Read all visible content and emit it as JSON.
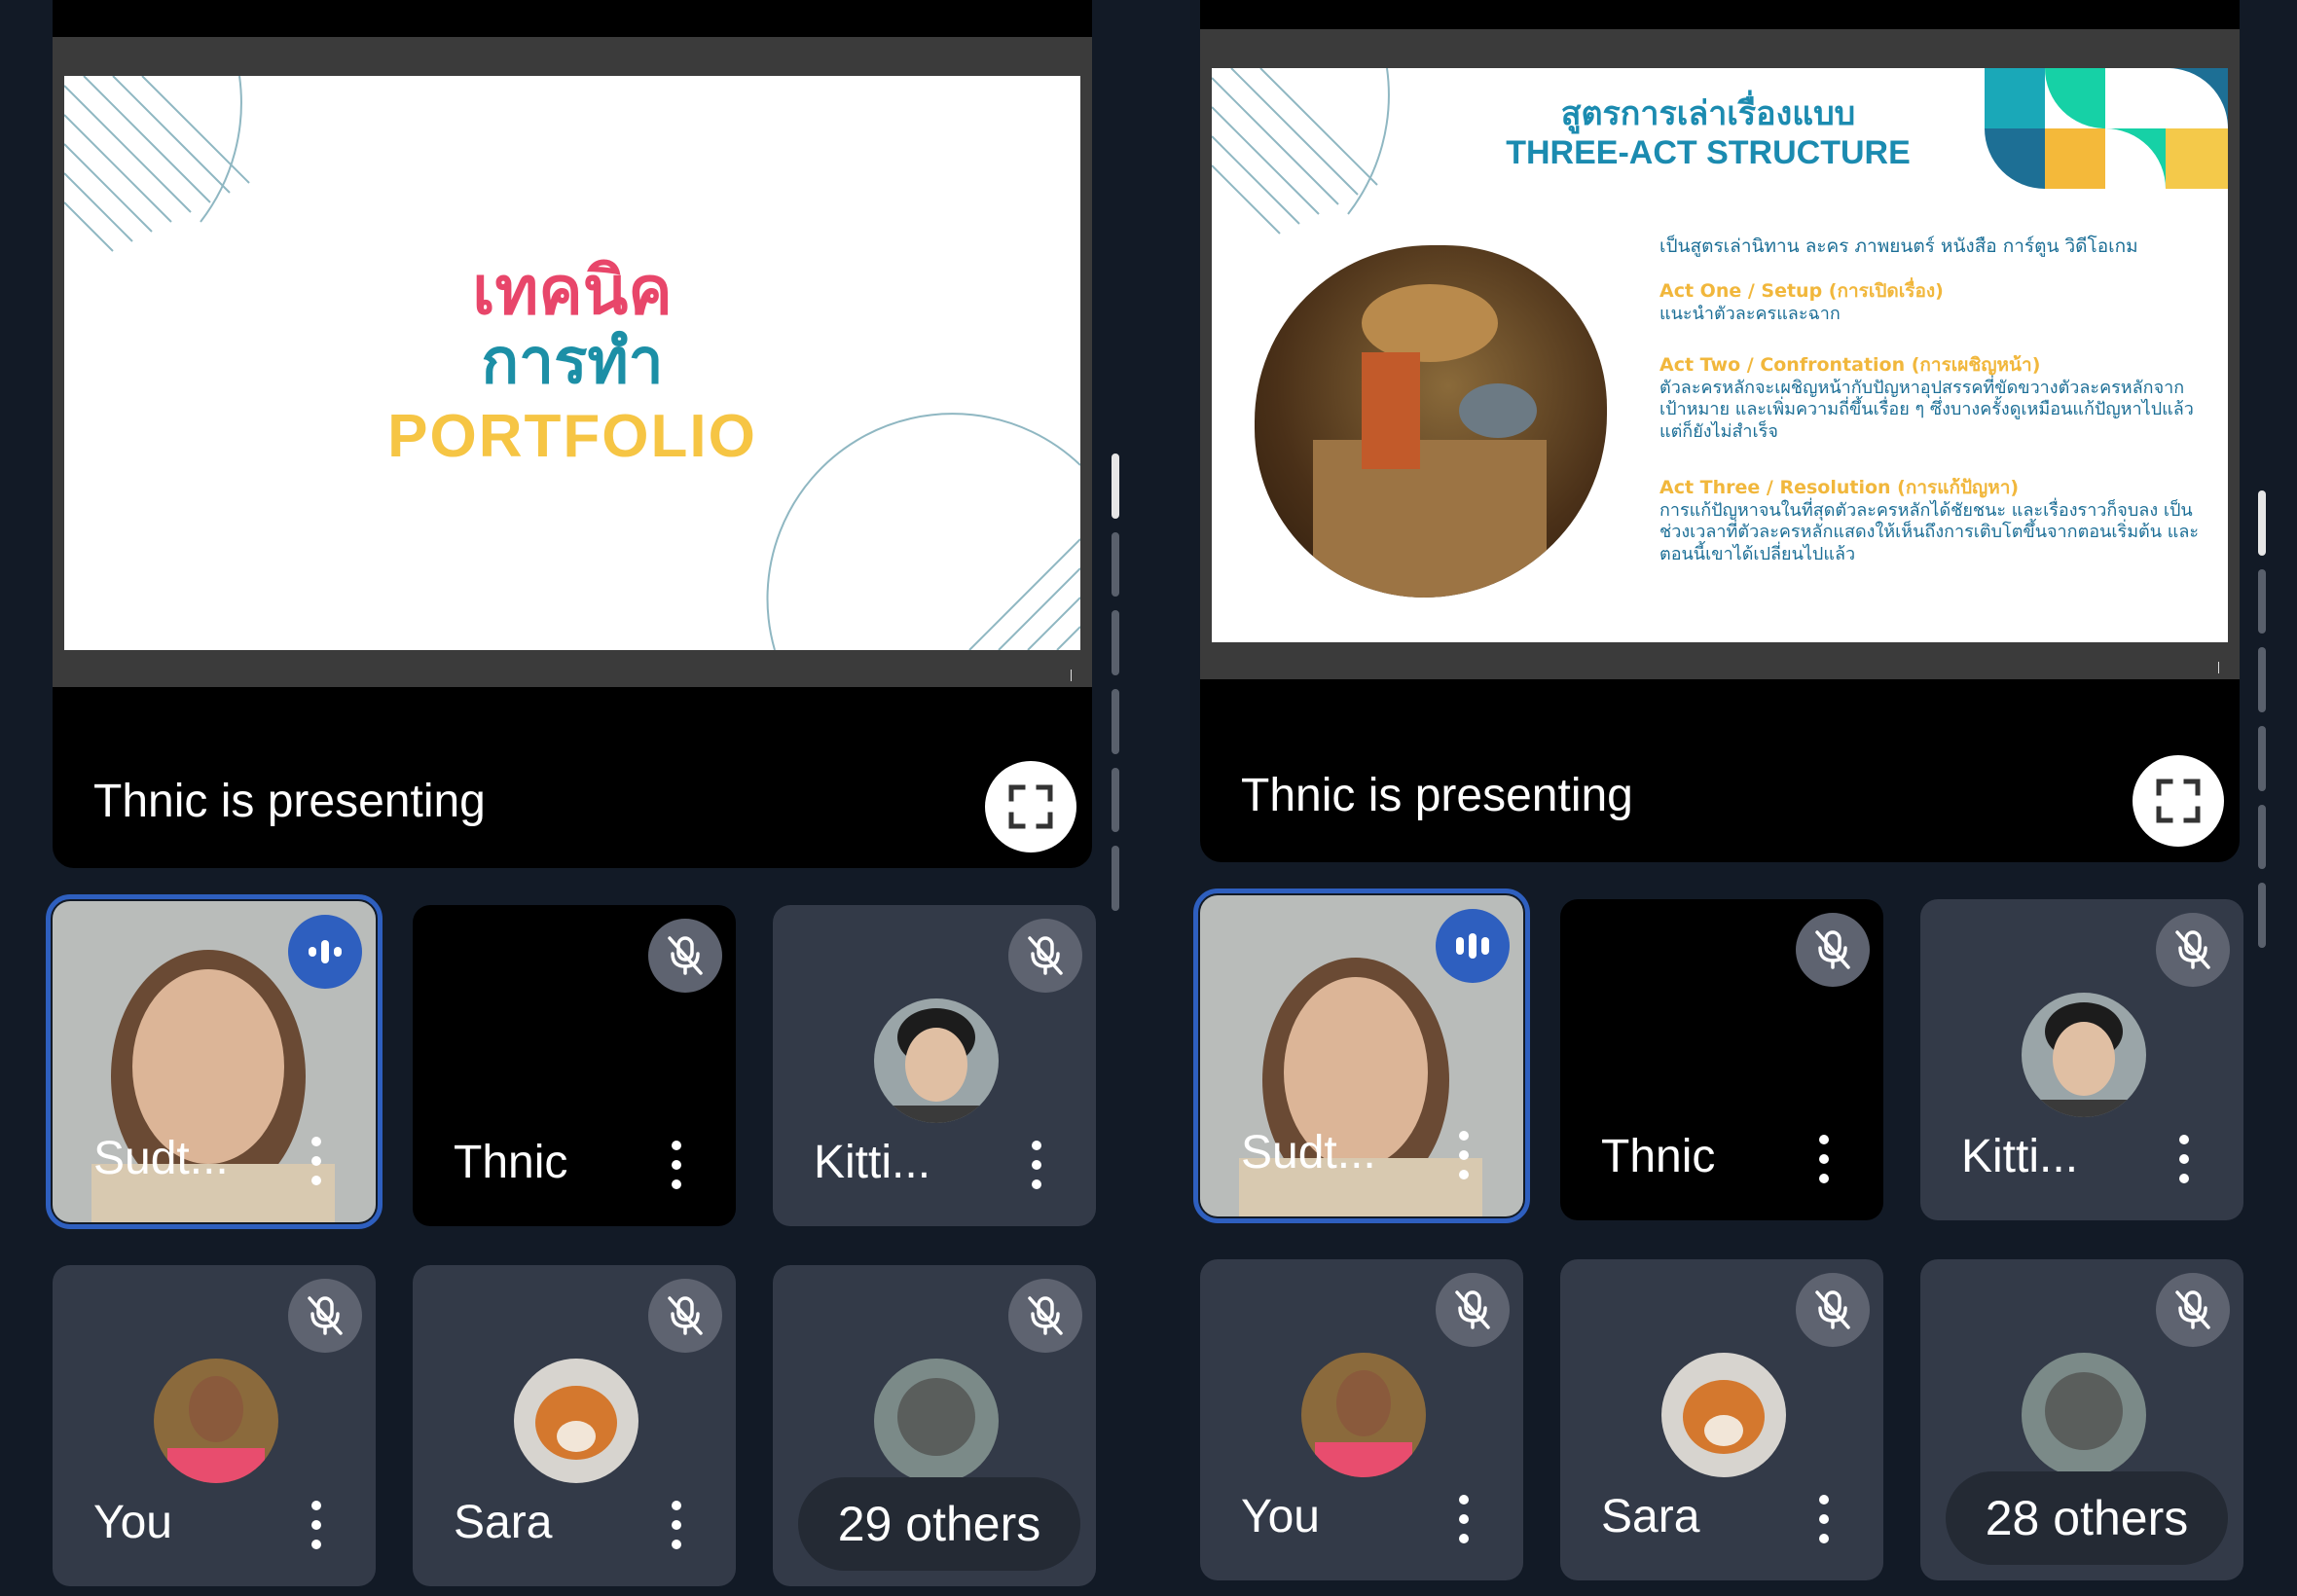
{
  "colors": {
    "background": "#121a26",
    "tile_bg": "#333a48",
    "active_outline": "#2e5fbf",
    "speaking_badge": "#2e5fbf",
    "muted_badge": "#5e6370",
    "slide1_line1": "#e8466a",
    "slide1_line2": "#1c8fa6",
    "slide1_line3": "#f6c544",
    "slide2_title": "#1b8bb0",
    "slide2_heading": "#f1b73c",
    "slide2_body": "#1b6e96"
  },
  "left": {
    "presenting_label": "Thnic is presenting",
    "slide": {
      "line1": "เทคนิค",
      "line2": "การทำ",
      "line3": "PORTFOLIO"
    },
    "tiles": [
      {
        "name": "Sudt...",
        "state": "speaking",
        "icon": "speaking-icon"
      },
      {
        "name": "Thnic",
        "state": "muted",
        "icon": "mic-off-icon"
      },
      {
        "name": "Kitti...",
        "state": "muted",
        "icon": "mic-off-icon"
      },
      {
        "name": "You",
        "state": "muted",
        "icon": "mic-off-icon"
      },
      {
        "name": "Sara",
        "state": "muted",
        "icon": "mic-off-icon"
      },
      {
        "name": "29 others",
        "state": "muted",
        "icon": "mic-off-icon"
      }
    ]
  },
  "right": {
    "presenting_label": "Thnic is presenting",
    "slide": {
      "title_line1": "สูตรการเล่าเรื่องแบบ",
      "title_line2": "THREE-ACT STRUCTURE",
      "intro": "เป็นสูตรเล่านิทาน ละคร ภาพยนตร์ หนังสือ การ์ตูน วิดีโอเกม",
      "sections": [
        {
          "heading": "Act One / Setup (การเปิดเรื่อง)",
          "body": "แนะนำตัวละครและฉาก"
        },
        {
          "heading": "Act Two / Confrontation (การเผชิญหน้า)",
          "body": "ตัวละครหลักจะเผชิญหน้ากับปัญหาอุปสรรคที่ขัดขวางตัวละครหลักจากเป้าหมาย และเพิ่มความถี่ขึ้นเรื่อย ๆ ซึ่งบางครั้งดูเหมือนแก้ปัญหาไปแล้ว แต่ก็ยังไม่สำเร็จ"
        },
        {
          "heading": "Act Three / Resolution (การแก้ปัญหา)",
          "body": "การแก้ปัญหาจนในที่สุดตัวละครหลักได้ชัยชนะ และเรื่องราวก็จบลง เป็นช่วงเวลาที่ตัวละครหลักแสดงให้เห็นถึงการเติบโตขึ้นจากตอนเริ่มต้น และตอนนี้เขาได้เปลี่ยนไปแล้ว"
        }
      ]
    },
    "tiles": [
      {
        "name": "Sudt...",
        "state": "speaking",
        "icon": "speaking-icon"
      },
      {
        "name": "Thnic",
        "state": "muted",
        "icon": "mic-off-icon"
      },
      {
        "name": "Kitti...",
        "state": "muted",
        "icon": "mic-off-icon"
      },
      {
        "name": "You",
        "state": "muted",
        "icon": "mic-off-icon"
      },
      {
        "name": "Sara",
        "state": "muted",
        "icon": "mic-off-icon"
      },
      {
        "name": "28 others",
        "state": "muted",
        "icon": "mic-off-icon"
      }
    ]
  }
}
